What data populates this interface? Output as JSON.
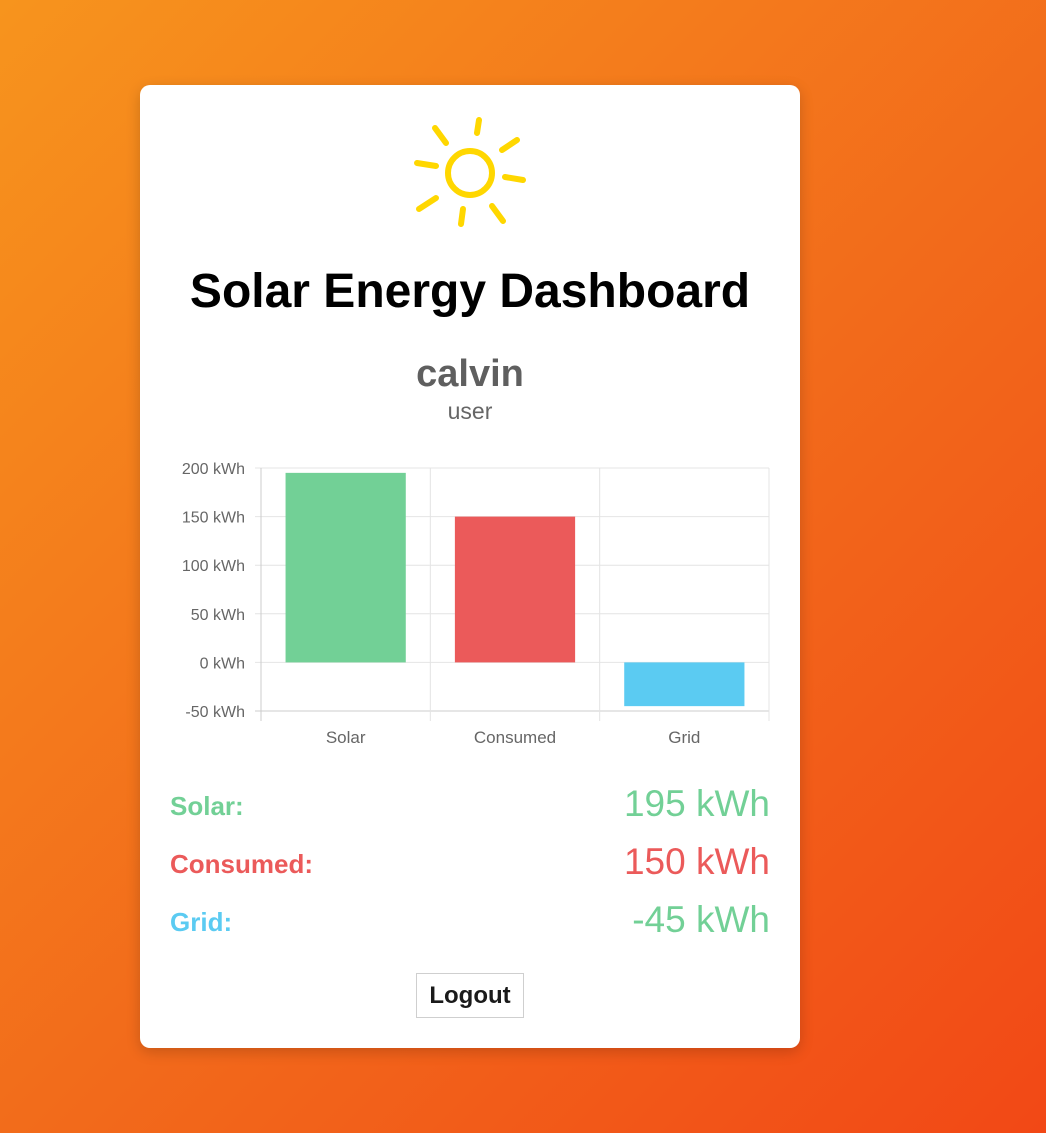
{
  "header": {
    "title": "Solar Energy Dashboard"
  },
  "user": {
    "name": "calvin",
    "role": "user"
  },
  "colors": {
    "solar": "#72d096",
    "consumed": "#eb5a5a",
    "grid": "#5bcbf2",
    "grid_value_text": "#72d096",
    "sun": "#ffd700"
  },
  "chart_data": {
    "type": "bar",
    "categories": [
      "Solar",
      "Consumed",
      "Grid"
    ],
    "values": [
      195,
      150,
      -45
    ],
    "ylim": [
      -50,
      200
    ],
    "yticks": [
      200,
      150,
      100,
      50,
      0,
      -50
    ],
    "ytick_labels": [
      "200 kWh",
      "150 kWh",
      "100 kWh",
      "50 kWh",
      "0 kWh",
      "-50 kWh"
    ],
    "grid": true,
    "legend": "none",
    "title": "",
    "xlabel": "",
    "ylabel": ""
  },
  "stats": [
    {
      "label": "Solar:",
      "value": "195 kWh"
    },
    {
      "label": "Consumed:",
      "value": "150 kWh"
    },
    {
      "label": "Grid:",
      "value": "-45 kWh"
    }
  ],
  "actions": {
    "logout_label": "Logout"
  },
  "icons": {
    "logo": "sun-icon"
  }
}
